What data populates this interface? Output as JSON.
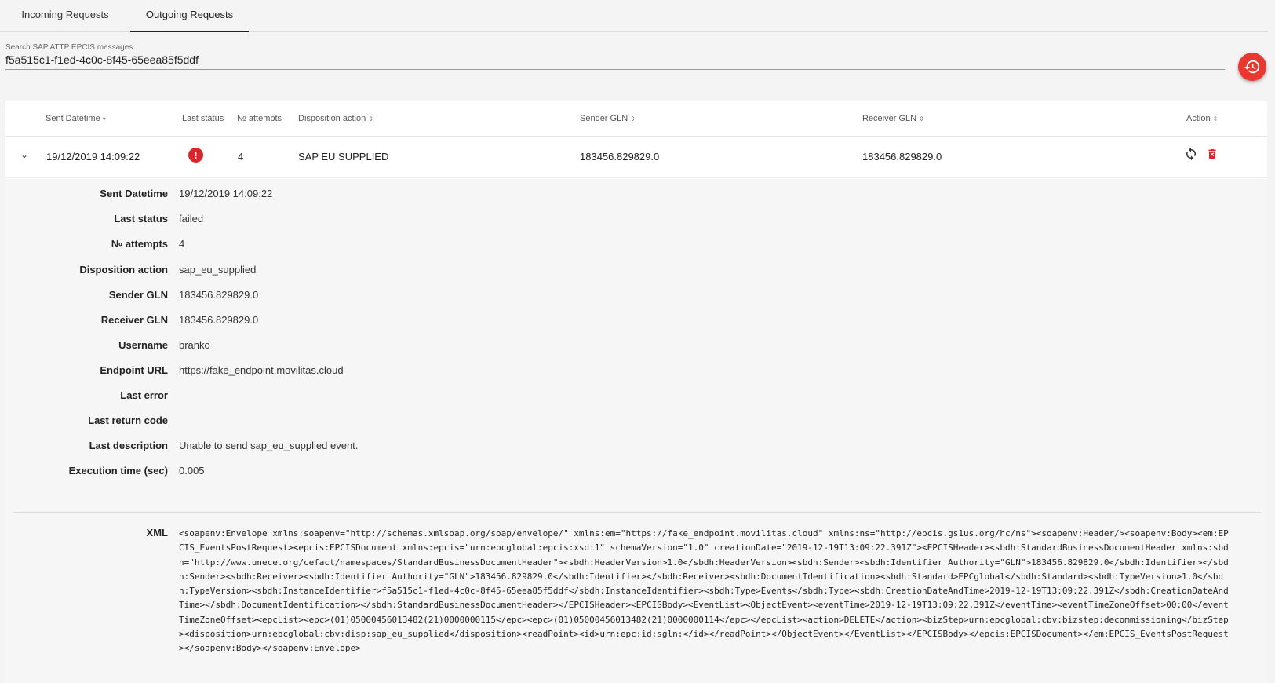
{
  "tabs": [
    {
      "label": "Incoming Requests",
      "active": false
    },
    {
      "label": "Outgoing Requests",
      "active": true
    }
  ],
  "search": {
    "label": "Search SAP ATTP EPCIS messages",
    "value": "f5a515c1-f1ed-4c0c-8f45-65eea85f5ddf"
  },
  "history_icon": "history-icon",
  "table": {
    "columns": {
      "sent_datetime": "Sent Datetime",
      "last_status": "Last status",
      "attempts": "№ attempts",
      "disposition": "Disposition action",
      "sender": "Sender GLN",
      "receiver": "Receiver GLN",
      "action": "Action"
    },
    "row": {
      "sent_datetime": "19/12/2019 14:09:22",
      "status_icon": "error-icon",
      "attempts": "4",
      "disposition": "SAP EU SUPPLIED",
      "sender": "183456.829829.0",
      "receiver": "183456.829829.0",
      "retry_icon": "retry-icon",
      "delete_icon": "delete-icon"
    }
  },
  "details": {
    "fields": [
      {
        "label": "Sent Datetime",
        "value": "19/12/2019 14:09:22"
      },
      {
        "label": "Last status",
        "value": "failed"
      },
      {
        "label": "№ attempts",
        "value": "4"
      },
      {
        "label": "Disposition action",
        "value": "sap_eu_supplied"
      },
      {
        "label": "Sender GLN",
        "value": "183456.829829.0"
      },
      {
        "label": "Receiver GLN",
        "value": "183456.829829.0"
      },
      {
        "label": "Username",
        "value": "branko"
      },
      {
        "label": "Endpoint URL",
        "value": "https://fake_endpoint.movilitas.cloud"
      },
      {
        "label": "Last error",
        "value": ""
      },
      {
        "label": "Last return code",
        "value": ""
      },
      {
        "label": "Last description",
        "value": "Unable to send sap_eu_supplied event."
      },
      {
        "label": "Execution time (sec)",
        "value": "0.005"
      }
    ],
    "xml_label": "XML",
    "xml": "<soapenv:Envelope xmlns:soapenv=\"http://schemas.xmlsoap.org/soap/envelope/\" xmlns:em=\"https://fake_endpoint.movilitas.cloud\" xmlns:ns=\"http://epcis.gs1us.org/hc/ns\"><soapenv:Header/><soapenv:Body><em:EPCIS_EventsPostRequest><epcis:EPCISDocument xmlns:epcis=\"urn:epcglobal:epcis:xsd:1\" schemaVersion=\"1.0\" creationDate=\"2019-12-19T13:09:22.391Z\"><EPCISHeader><sbdh:StandardBusinessDocumentHeader xmlns:sbdh=\"http://www.unece.org/cefact/namespaces/StandardBusinessDocumentHeader\"><sbdh:HeaderVersion>1.0</sbdh:HeaderVersion><sbdh:Sender><sbdh:Identifier Authority=\"GLN\">183456.829829.0</sbdh:Identifier></sbdh:Sender><sbdh:Receiver><sbdh:Identifier Authority=\"GLN\">183456.829829.0</sbdh:Identifier></sbdh:Receiver><sbdh:DocumentIdentification><sbdh:Standard>EPCglobal</sbdh:Standard><sbdh:TypeVersion>1.0</sbdh:TypeVersion><sbdh:InstanceIdentifier>f5a515c1-f1ed-4c0c-8f45-65eea85f5ddf</sbdh:InstanceIdentifier><sbdh:Type>Events</sbdh:Type><sbdh:CreationDateAndTime>2019-12-19T13:09:22.391Z</sbdh:CreationDateAndTime></sbdh:DocumentIdentification></sbdh:StandardBusinessDocumentHeader></EPCISHeader><EPCISBody><EventList><ObjectEvent><eventTime>2019-12-19T13:09:22.391Z</eventTime><eventTimeZoneOffset>00:00</eventTimeZoneOffset><epcList><epc>(01)05000456013482(21)0000000115</epc><epc>(01)05000456013482(21)0000000114</epc></epcList><action>DELETE</action><bizStep>urn:epcglobal:cbv:bizstep:decommissioning</bizStep><disposition>urn:epcglobal:cbv:disp:sap_eu_supplied</disposition><readPoint><id>urn:epc:id:sgln:</id></readPoint></ObjectEvent></EventList></EPCISBody></epcis:EPCISDocument></em:EPCIS_EventsPostRequest></soapenv:Body></soapenv:Envelope>"
  },
  "colors": {
    "accent": "#e8382f",
    "error": "#d9262d"
  }
}
